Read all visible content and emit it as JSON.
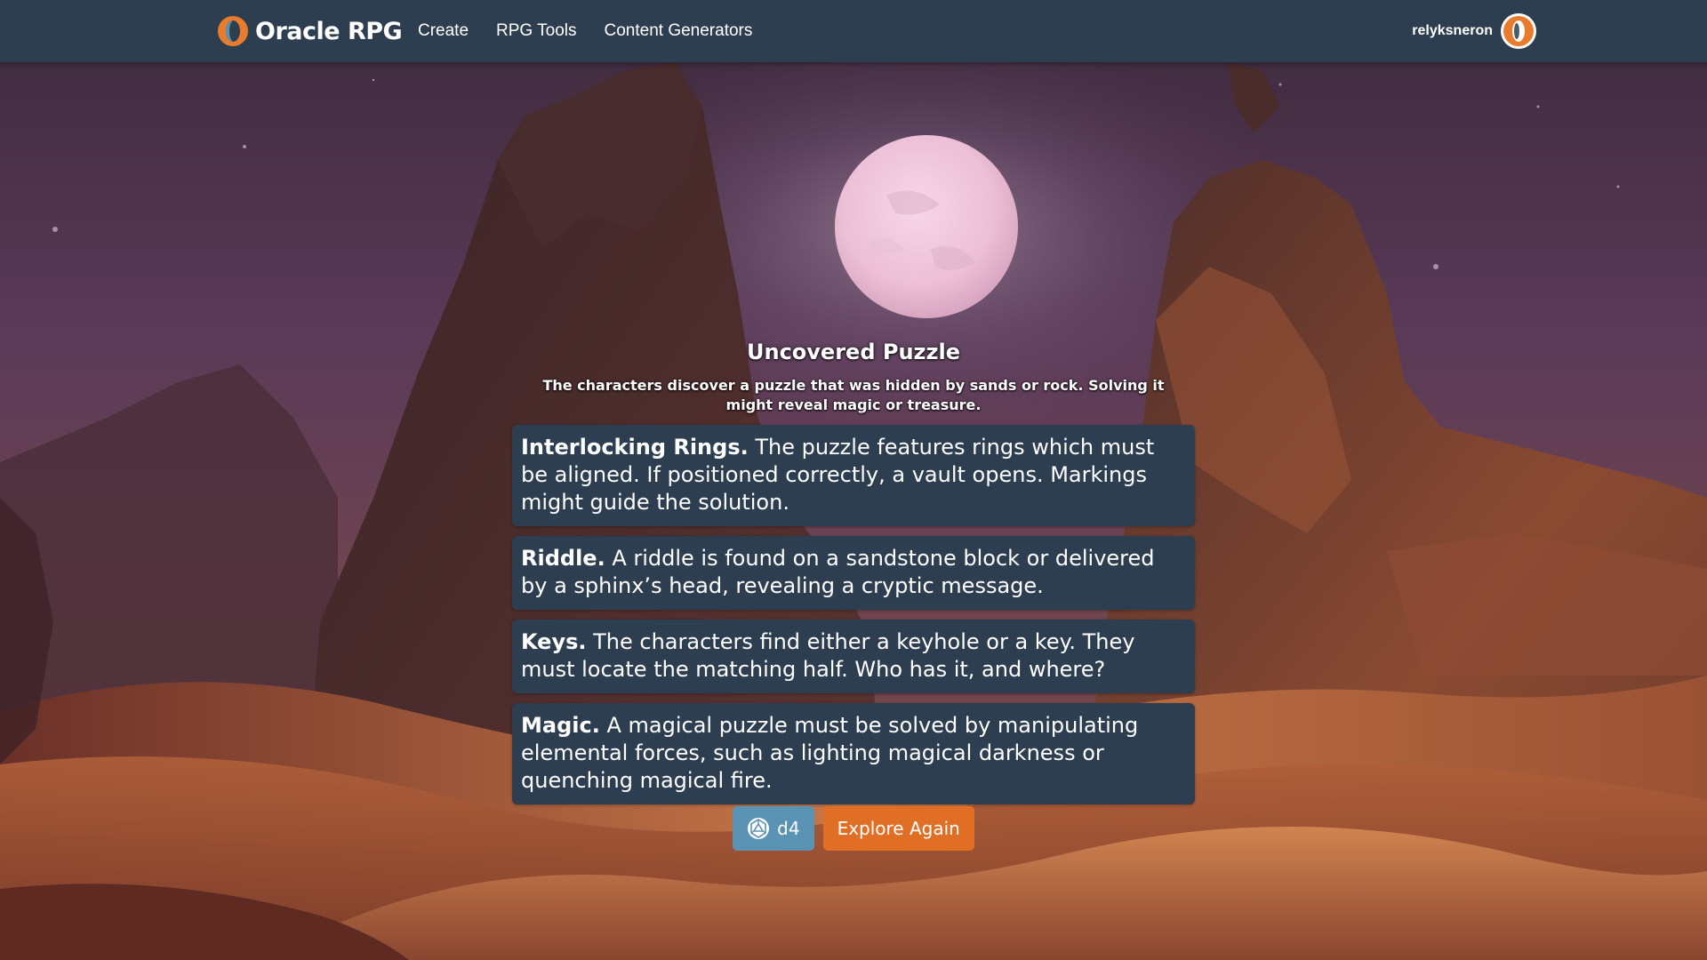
{
  "brand": {
    "name": "Oracle RPG",
    "logo_icon": "ring-logo-icon"
  },
  "nav": {
    "items": [
      {
        "label": "Create"
      },
      {
        "label": "RPG Tools"
      },
      {
        "label": "Content Generators"
      }
    ]
  },
  "user": {
    "username": "relyksneron",
    "avatar_icon": "ring-avatar-icon"
  },
  "result": {
    "illustration": "moon-icon",
    "title": "Uncovered Puzzle",
    "description": "The characters discover a puzzle that was hidden by sands or rock. Solving it might reveal magic or treasure.",
    "options": [
      {
        "name": "Interlocking Rings.",
        "text": " The puzzle features rings which must be aligned. If positioned correctly, a vault opens. Markings might guide the solution."
      },
      {
        "name": "Riddle.",
        "text": " A riddle is found on a sandstone block or delivered by a sphinx’s head, revealing a cryptic message."
      },
      {
        "name": "Keys.",
        "text": " The characters find either a keyhole or a key. They must locate the matching half. Who has it, and where?"
      },
      {
        "name": "Magic.",
        "text": " A magical puzzle must be solved by manipulating elemental forces, such as lighting magical darkness or quenching magical fire."
      }
    ]
  },
  "actions": {
    "dice_label": "d4",
    "dice_icon": "d20-dice-icon",
    "explore_label": "Explore Again"
  },
  "colors": {
    "navbar": "#2c3e50",
    "card": "#2c3e50",
    "dice_button": "#5a93b4",
    "explore_button": "#e06e24",
    "accent_orange": "#e87b2c"
  }
}
